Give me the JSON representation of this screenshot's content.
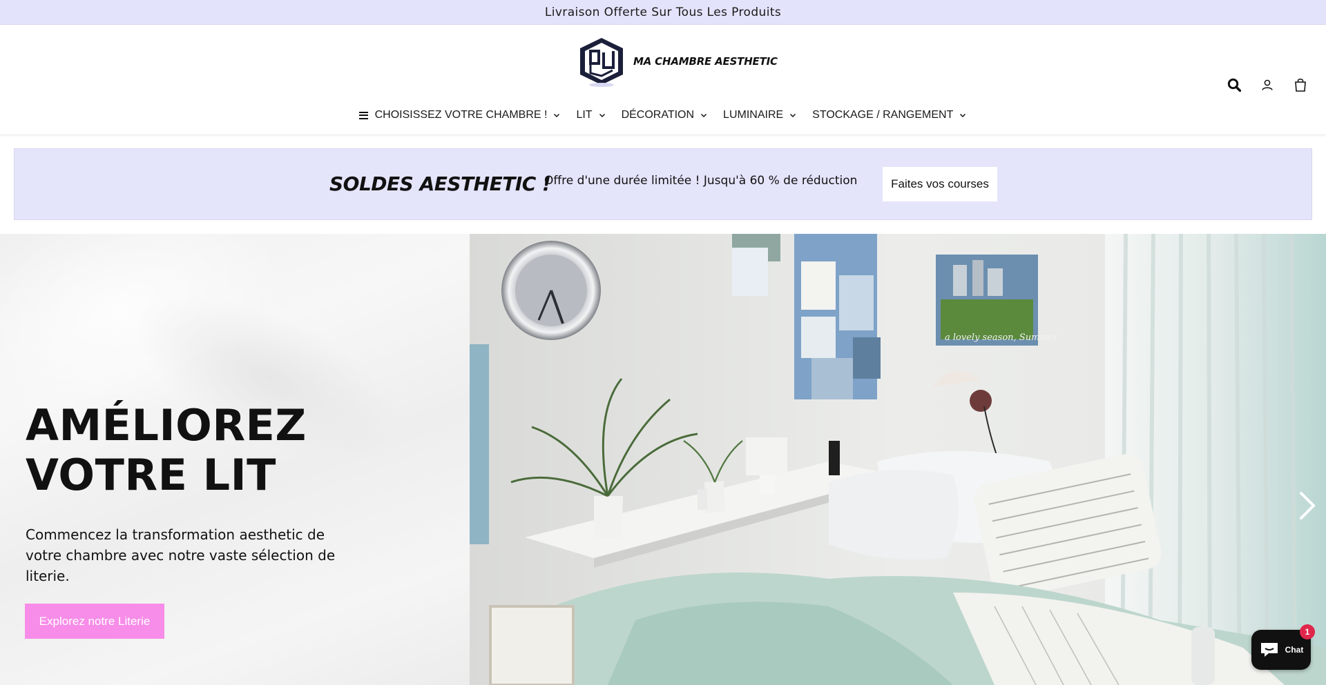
{
  "announcement": {
    "text": "Livraison Offerte Sur Tous Les Produits"
  },
  "header": {
    "brand": "MA CHAMBRE AESTHETIC",
    "icons": [
      "search-icon",
      "account-icon",
      "cart-icon"
    ]
  },
  "nav": {
    "items": [
      {
        "label": "CHOISISSEZ VOTRE CHAMBRE !",
        "icon": "menu-icon",
        "has_dropdown": true
      },
      {
        "label": "LIT",
        "has_dropdown": true
      },
      {
        "label": "DÉCORATION",
        "has_dropdown": true
      },
      {
        "label": "LUMINAIRE",
        "has_dropdown": true
      },
      {
        "label": "STOCKAGE / RANGEMENT",
        "has_dropdown": true
      }
    ]
  },
  "promo": {
    "title": "SOLDES AESTHETIC !",
    "text": "Offre d'une durée limitée ! Jusqu'à 60 % de réduction",
    "button_label": "Faites vos courses",
    "background": "#e4e4fb"
  },
  "hero": {
    "title_line1": "AMÉLIOREZ",
    "title_line2": "VOTRE LIT",
    "description": "Commencez la transformation aesthetic de votre chambre avec notre vaste sélection de literie.",
    "button_label": "Explorez notre Literie",
    "button_color": "#f78de8",
    "image_caption": "a lovely season, Summer",
    "next_icon": "chevron-right-icon"
  },
  "chat": {
    "label": "Chat",
    "badge": "1"
  }
}
